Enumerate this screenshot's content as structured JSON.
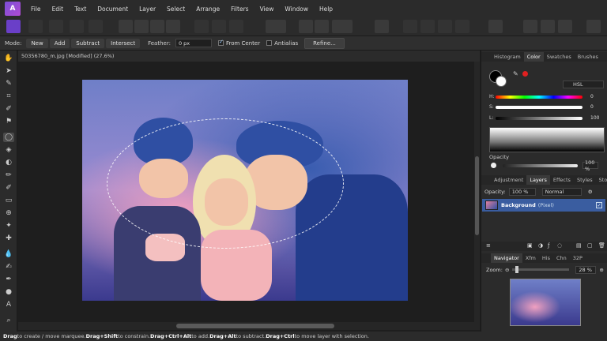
{
  "menu": {
    "logo": "A",
    "items": [
      "File",
      "Edit",
      "Text",
      "Document",
      "Layer",
      "Select",
      "Arrange",
      "Filters",
      "View",
      "Window",
      "Help"
    ]
  },
  "context": {
    "mode_label": "Mode:",
    "modes": [
      "New",
      "Add",
      "Subtract",
      "Intersect"
    ],
    "feather_label": "Feather:",
    "feather_value": "0 px",
    "from_center": "From Center",
    "antialias": "Antialias",
    "refine": "Refine..."
  },
  "document": {
    "tab_title": "50356780_m.jpg [Modified] (27.6%)"
  },
  "status": {
    "drag1": "Drag",
    "t1": " to create / move marquee. ",
    "drag2": "Drag+Shift",
    "t2": " to constrain. ",
    "drag3": "Drag+Ctrl+Alt",
    "t3": " to add. ",
    "drag4": "Drag+Alt",
    "t4": " to subtract. ",
    "drag5": "Drag+Ctrl",
    "t5": " to move layer with selection."
  },
  "color_panel": {
    "tabs": [
      "Histogram",
      "Color",
      "Swatches",
      "Brushes"
    ],
    "model": "HSL",
    "sliders": [
      {
        "label": "H:",
        "value": "0"
      },
      {
        "label": "S:",
        "value": "0"
      },
      {
        "label": "L:",
        "value": "100"
      }
    ],
    "opacity_label": "Opacity",
    "opacity_value": "100 %"
  },
  "layers_panel": {
    "tabs": [
      "Adjustment",
      "Layers",
      "Effects",
      "Styles",
      "Stock"
    ],
    "opacity_label": "Opacity:",
    "opacity_value": "100 %",
    "blend_mode": "Normal",
    "layer_name": "Background",
    "layer_type": "(Pixel)"
  },
  "navigator": {
    "tabs": [
      "Navigator",
      "Xfm",
      "His",
      "Chn",
      "32P"
    ],
    "zoom_label": "Zoom:",
    "zoom_value": "28 %"
  }
}
